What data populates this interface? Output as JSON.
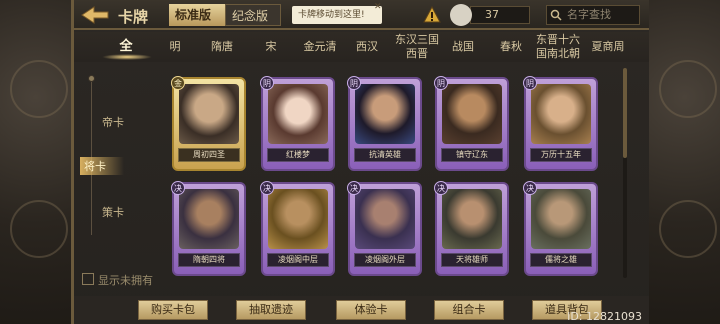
{
  "header": {
    "title": "卡牌",
    "version_tabs": [
      "标准版",
      "纪念版"
    ],
    "tooltip": "卡牌移动到这里!",
    "coin_count": "37",
    "search_placeholder": "名字查找"
  },
  "dynasty_tabs": [
    "全",
    "明",
    "隋唐",
    "宋",
    "金元清",
    "西汉",
    "东汉三国西晋",
    "战国",
    "春秋",
    "东晋十六国南北朝",
    "夏商周"
  ],
  "sidebar": {
    "items": [
      "帝卡",
      "将卡",
      "策卡"
    ],
    "active": "将卡",
    "show_unowned_label": "显示未拥有"
  },
  "cards": [
    {
      "badge": "金",
      "name": "周初四圣"
    },
    {
      "badge": "阴",
      "name": "红楼梦"
    },
    {
      "badge": "阴",
      "name": "抗清英雄"
    },
    {
      "badge": "阴",
      "name": "镇守辽东"
    },
    {
      "badge": "阴",
      "name": "万历十五年"
    },
    {
      "badge": "决",
      "name": "隋朝四将"
    },
    {
      "badge": "决",
      "name": "凌烟阁中层"
    },
    {
      "badge": "决",
      "name": "凌烟阁外层"
    },
    {
      "badge": "决",
      "name": "天将雄师"
    },
    {
      "badge": "决",
      "name": "儒将之雄"
    }
  ],
  "bottom_buttons": [
    "购买卡包",
    "抽取遗迹",
    "体验卡",
    "组合卡",
    "道具背包"
  ],
  "user_id": "ID: 12821093",
  "colors": {
    "accent_gold": "#c9a24f",
    "card_purple": "#8a5fb8",
    "frame_brown": "#6b5a3c"
  }
}
